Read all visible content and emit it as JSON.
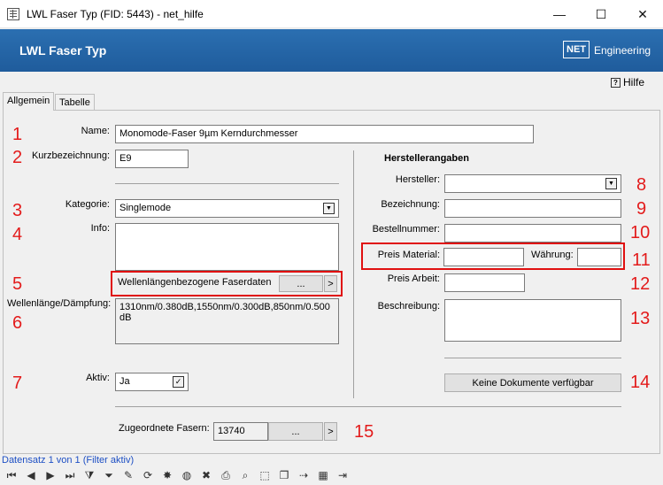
{
  "window": {
    "title": "LWL Faser Typ (FID: 5443) - net_hilfe",
    "minimize": "—",
    "maximize": "☐",
    "close": "✕"
  },
  "banner": {
    "title": "LWL Faser Typ",
    "logo_net": "NET",
    "logo_engineering": "Engineering"
  },
  "help": {
    "label": "Hilfe",
    "icon_glyph": "?"
  },
  "tabs": [
    {
      "label": "Allgemein",
      "active": true
    },
    {
      "label": "Tabelle",
      "active": false
    }
  ],
  "form": {
    "name_label": "Name:",
    "name_value": "Monomode-Faser 9µm Kerndurchmesser",
    "kurz_label": "Kurzbezeichnung:",
    "kurz_value": "E9",
    "kategorie_label": "Kategorie:",
    "kategorie_value": "Singlemode",
    "info_label": "Info:",
    "info_value": "",
    "faserdaten_label": "Wellenlängenbezogene Faserdaten",
    "faserdaten_btn": "...",
    "faserdaten_arrow": ">",
    "wellen_label": "Wellenlänge/Dämpfung:",
    "wellen_value": "1310nm/0.380dB,1550nm/0.300dB,850nm/0.500dB",
    "aktiv_label": "Aktiv:",
    "aktiv_value": "Ja",
    "aktiv_check": "✓",
    "fasern_label": "Zugeordnete Fasern:",
    "fasern_value": "13740",
    "fasern_btn": "...",
    "fasern_arrow": ">"
  },
  "hersteller": {
    "heading": "Herstellerangaben",
    "hersteller_label": "Hersteller:",
    "hersteller_value": "",
    "bezeichnung_label": "Bezeichnung:",
    "bezeichnung_value": "",
    "bestell_label": "Bestellnummer:",
    "bestell_value": "",
    "preis_material_label": "Preis Material:",
    "preis_material_value": "",
    "waehrung_label": "Währung:",
    "waehrung_value": "",
    "preis_arbeit_label": "Preis Arbeit:",
    "preis_arbeit_value": "",
    "beschreibung_label": "Beschreibung:",
    "beschreibung_value": "",
    "dokumente_btn": "Keine Dokumente verfügbar"
  },
  "annotations": [
    "1",
    "2",
    "3",
    "4",
    "5",
    "6",
    "7",
    "8",
    "9",
    "10",
    "11",
    "12",
    "13",
    "14",
    "15"
  ],
  "status": "Datensatz 1 von 1 (Filter aktiv)",
  "toolbar": [
    {
      "icon": "first-record-icon",
      "glyph": "⏮"
    },
    {
      "icon": "prev-record-icon",
      "glyph": "◀"
    },
    {
      "icon": "next-record-icon",
      "glyph": "▶"
    },
    {
      "icon": "last-record-icon",
      "glyph": "⏭"
    },
    {
      "icon": "add-filter-icon",
      "glyph": "⧩"
    },
    {
      "icon": "filter-icon",
      "glyph": "⏷"
    },
    {
      "icon": "edit-icon",
      "glyph": "✎"
    },
    {
      "icon": "refresh-icon",
      "glyph": "⟳"
    },
    {
      "icon": "new-icon",
      "glyph": "✸"
    },
    {
      "icon": "globe-icon",
      "glyph": "◍"
    },
    {
      "icon": "delete-icon",
      "glyph": "✖"
    },
    {
      "icon": "print-icon",
      "glyph": "⎙"
    },
    {
      "icon": "zoom-icon",
      "glyph": "⌕"
    },
    {
      "icon": "select-icon",
      "glyph": "⬚"
    },
    {
      "icon": "copy-icon",
      "glyph": "❐"
    },
    {
      "icon": "move-icon",
      "glyph": "⇢"
    },
    {
      "icon": "table-icon",
      "glyph": "▦"
    },
    {
      "icon": "exit-icon",
      "glyph": "⇥"
    }
  ],
  "colors": {
    "banner": "#2b6fb1",
    "annotation": "#e31b1b",
    "highlight_box": "#e01010",
    "status_text": "#1d4fc4"
  }
}
